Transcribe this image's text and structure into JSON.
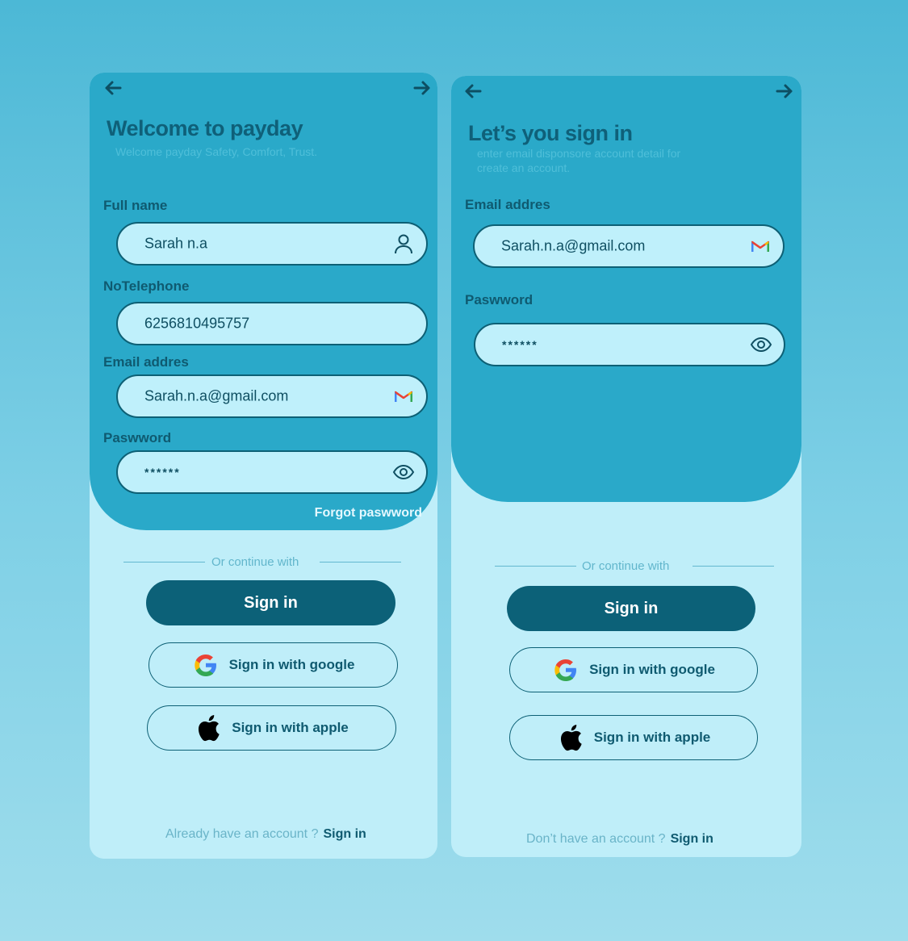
{
  "signup": {
    "title": "Welcome to payday",
    "subtitle": "Welcome payday Safety, Comfort, Trust.",
    "fields": {
      "fullname": {
        "label": "Full name",
        "value": "Sarah n.a",
        "icon": "user-icon"
      },
      "phone": {
        "label": "NoTelephone",
        "value": "6256810495757"
      },
      "email": {
        "label": "Email addres",
        "value": "Sarah.n.a@gmail.com",
        "icon": "gmail-icon"
      },
      "password": {
        "label": "Paswword",
        "value": "******",
        "icon": "eye-icon"
      }
    },
    "forgot_label": "Forgot paswword",
    "divider_label": "Or continue with",
    "signin_label": "Sign in",
    "google_label": "Sign in with google",
    "apple_label": "Sign in with apple",
    "footer_text": "Already have an account ?",
    "footer_link": "Sign in"
  },
  "signin": {
    "title": "Let’s you sign in",
    "subtitle_line1": "enter email disponsore account detail for",
    "subtitle_line2": "create an account.",
    "fields": {
      "email": {
        "label": "Email addres",
        "value": "Sarah.n.a@gmail.com",
        "icon": "gmail-icon"
      },
      "password": {
        "label": "Paswword",
        "value": "******",
        "icon": "eye-icon"
      }
    },
    "divider_label": "Or continue with",
    "signin_label": "Sign in",
    "google_label": "Sign in with google",
    "apple_label": "Sign in with apple",
    "footer_text": "Don’t  have an account ?",
    "footer_link": "Sign in"
  },
  "colors": {
    "panel": "#2aa9c9",
    "card": "#bfeef9",
    "primary_button": "#0c6178",
    "text_dark": "#0f5a70"
  }
}
